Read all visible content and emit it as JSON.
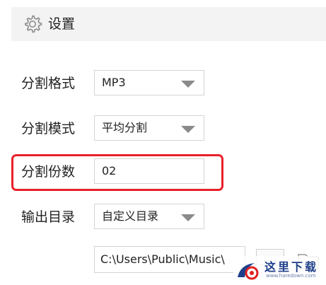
{
  "header": {
    "title": "设置",
    "icon": "gear-icon"
  },
  "fields": {
    "split_format": {
      "label": "分割格式",
      "value": "MP3"
    },
    "split_mode": {
      "label": "分割模式",
      "value": "平均分割"
    },
    "split_count": {
      "label": "分割份数",
      "value": "02"
    },
    "output_dir": {
      "label": "输出目录",
      "value": "自定义目录",
      "path": "C:\\Users\\Public\\Music\\"
    }
  },
  "watermark": {
    "text": "这里下载",
    "url": "www.haredown.com"
  },
  "colors": {
    "highlight": "#e8202a",
    "header_bg": "#f3f3f3",
    "border": "#d4d4d4",
    "watermark": "#1f3f8a"
  }
}
